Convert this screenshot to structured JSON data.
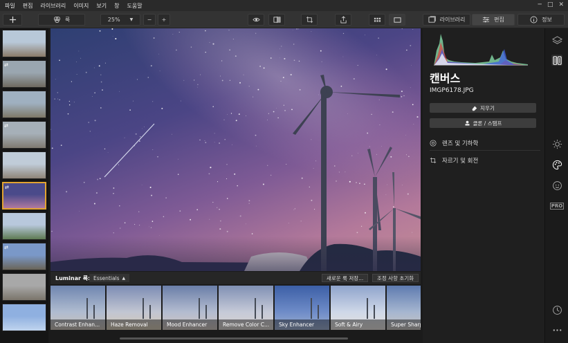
{
  "menu": {
    "items": [
      "파일",
      "편집",
      "라이브러리",
      "이미지",
      "보기",
      "창",
      "도움말"
    ]
  },
  "window_controls": [
    "─",
    "□",
    "✕"
  ],
  "toolbar": {
    "add_icon": "plus-icon",
    "looks_label": "룩",
    "zoom_value": "25%",
    "zoom_minus": "−",
    "zoom_plus": "+",
    "library_label": "라이브러리",
    "edit_label": "편집",
    "info_label": "정보"
  },
  "filmstrip": {
    "thumbnails": [
      {
        "colors": [
          "#b8c8d8",
          "#8a7a68"
        ],
        "marked": false,
        "selected": false
      },
      {
        "colors": [
          "#9aa6b0",
          "#6f6a60"
        ],
        "marked": true,
        "selected": false
      },
      {
        "colors": [
          "#9fb0c0",
          "#7e7868"
        ],
        "marked": false,
        "selected": false
      },
      {
        "colors": [
          "#a6b0b8",
          "#807a70"
        ],
        "marked": true,
        "selected": false
      },
      {
        "colors": [
          "#c0ccd8",
          "#8e8478"
        ],
        "marked": false,
        "selected": false
      },
      {
        "colors": [
          "#4a4a8a",
          "#b07aa0"
        ],
        "marked": true,
        "selected": true
      },
      {
        "colors": [
          "#b8c8dc",
          "#5e7a52"
        ],
        "marked": false,
        "selected": false
      },
      {
        "colors": [
          "#7a98c8",
          "#6a6458"
        ],
        "marked": true,
        "selected": false
      },
      {
        "colors": [
          "#a8a8a8",
          "#7a746a"
        ],
        "marked": false,
        "selected": false
      },
      {
        "colors": [
          "#8fb0e0",
          "#c0d4ee"
        ],
        "marked": false,
        "selected": false
      }
    ],
    "mark_glyph": "⇄"
  },
  "presets": {
    "bar_label": "Luminar 룩:",
    "collection": "Essentials",
    "save_button": "새로운 룩 저장...",
    "reset_button": "조정 사항 초기화",
    "items": [
      {
        "name": "Contrast Enhan..."
      },
      {
        "name": "Haze Removal"
      },
      {
        "name": "Mood Enhancer"
      },
      {
        "name": "Remove Color C..."
      },
      {
        "name": "Sky Enhancer"
      },
      {
        "name": "Soft & Airy"
      },
      {
        "name": "Super Sharp"
      }
    ]
  },
  "panel": {
    "title": "캔버스",
    "filename": "IMGP6178.JPG",
    "erase_button": "지우기",
    "clone_button": "클론 / 스탬프",
    "lens_tool": "렌즈 및 기하학",
    "crop_tool": "자르기 및 회전"
  },
  "rail": {
    "pro_label": "PRO"
  },
  "colors": {
    "accent_selected": "#e3a430",
    "panel_bg": "#1f1f1f"
  }
}
